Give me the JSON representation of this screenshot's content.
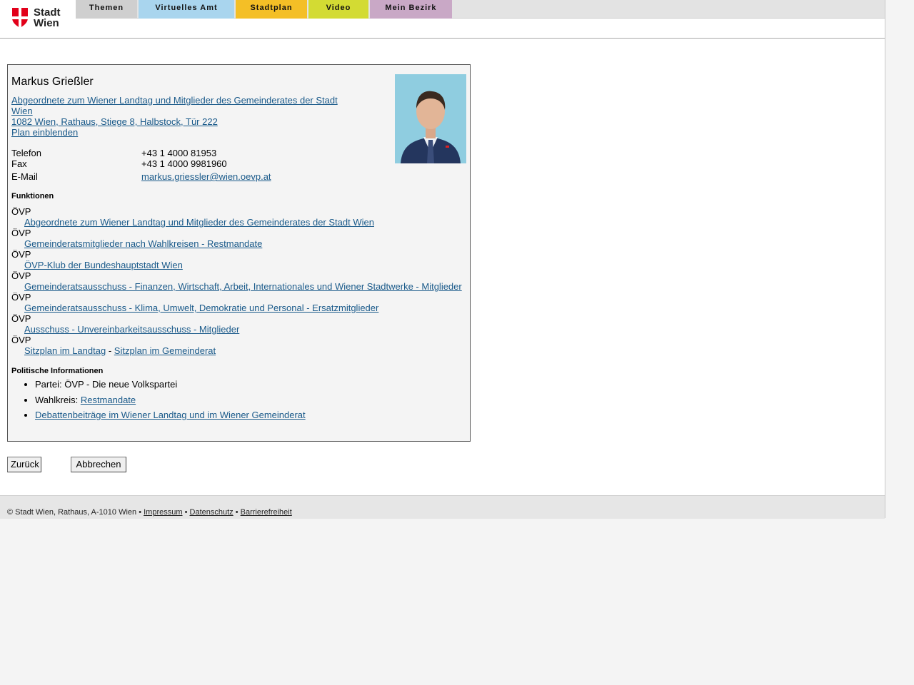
{
  "header": {
    "logo_line1": "Stadt",
    "logo_line2": "Wien",
    "tabs": [
      "Themen",
      "Virtuelles Amt",
      "Stadtplan",
      "Video",
      "Mein Bezirk"
    ]
  },
  "person": {
    "name": "Markus Grießler",
    "role": "Abgeordnete zum Wiener Landtag und Mitglieder des Gemeinderates der Stadt Wien",
    "address": "1082 Wien, Rathaus, Stiege 8, Halbstock, Tür 222",
    "map_link": "Plan einblenden",
    "contacts": [
      {
        "label": "Telefon",
        "value": "+43 1 4000 81953"
      },
      {
        "label": "Fax",
        "value": "+43 1 4000 9981960"
      },
      {
        "label": "E-Mail",
        "value": "markus.griessler@wien.oevp.at"
      }
    ]
  },
  "functions": {
    "heading": "Funktionen",
    "items": [
      {
        "party": "ÖVP",
        "link": "Abgeordnete zum Wiener Landtag und Mitglieder des Gemeinderates der Stadt Wien"
      },
      {
        "party": "ÖVP",
        "link": "Gemeinderatsmitglieder nach Wahlkreisen - Restmandate"
      },
      {
        "party": "ÖVP",
        "link": "ÖVP-Klub der Bundeshauptstadt Wien"
      },
      {
        "party": "ÖVP",
        "link": "Gemeinderatsausschuss - Finanzen, Wirtschaft, Arbeit, Internationales und Wiener Stadtwerke - Mitglieder"
      },
      {
        "party": "ÖVP",
        "link": "Gemeinderatsausschuss - Klima, Umwelt, Demokratie und Personal - Ersatzmitglieder"
      },
      {
        "party": "ÖVP",
        "link": "Ausschuss - Unvereinbarkeitsausschuss - Mitglieder"
      }
    ],
    "seating_party": "ÖVP",
    "seating_landtag": "Sitzplan im Landtag",
    "seating_sep": "-",
    "seating_gemeinderat": "Sitzplan im Gemeinderat"
  },
  "political": {
    "heading": "Politische Informationen",
    "party_prefix": "Partei:",
    "party_value": "ÖVP - Die neue Volkspartei",
    "district_prefix": "Wahlkreis:",
    "district_link": "Restmandate",
    "debates_link": "Debattenbeiträge im Wiener Landtag und im Wiener Gemeinderat"
  },
  "buttons": {
    "back": "Zurück",
    "cancel": "Abbrechen"
  },
  "footer": {
    "copyright": "© Stadt Wien, Rathaus, A-1010 Wien",
    "sep": "•",
    "impressum": "Impressum",
    "datenschutz": "Datenschutz",
    "barrierefreiheit": "Barrierefreiheit"
  },
  "colors": {
    "tab_themen": "#cfcfcf",
    "tab_amt": "#a9d5ee",
    "tab_plan": "#f4bf26",
    "tab_video": "#d3db33",
    "tab_bezirk": "#c9a8c6",
    "link": "#1a5a8a",
    "logo_red": "#e2001a"
  }
}
